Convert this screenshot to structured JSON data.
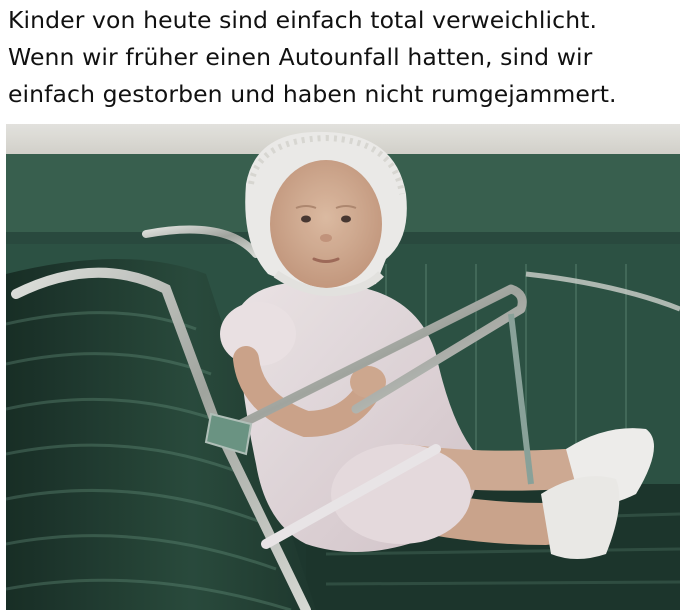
{
  "caption": {
    "lines": [
      "Kinder von heute sind einfach total verweichlicht.",
      "Wenn wir früher einen Autounfall hatten, sind wir",
      "einfach gestorben und haben nicht rumgejammert."
    ]
  },
  "photo": {
    "subject-icon": "baby-in-car-seat-icon",
    "colors": {
      "seat_green": "#2f5748",
      "seat_dark": "#16291f",
      "chrome": "#c9ccc6",
      "dress": "#efe4e6",
      "skin": "#d9b49b",
      "background_light": "#e9e6df"
    }
  }
}
